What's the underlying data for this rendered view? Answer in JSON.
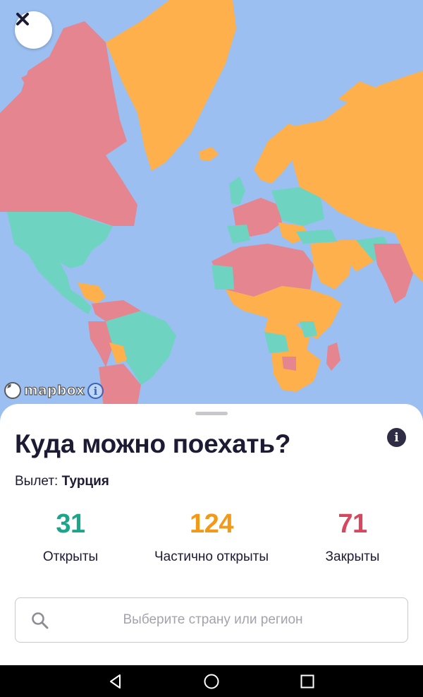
{
  "map": {
    "colors": {
      "water": "#9bbff0",
      "open": "#6fd3c1",
      "partial": "#fdb04c",
      "closed": "#e5858f"
    },
    "attribution_logo": "mapbox",
    "close_icon": "close-icon",
    "info_icon": "info-icon"
  },
  "sheet": {
    "title": "Куда можно поехать?",
    "departure_label": "Вылет:",
    "departure_country": "Турция",
    "stats": [
      {
        "value": "31",
        "label": "Открыты",
        "color": "#1aa68a"
      },
      {
        "value": "124",
        "label": "Частично открыты",
        "color": "#f29a17"
      },
      {
        "value": "71",
        "label": "Закрыты",
        "color": "#d64860"
      }
    ],
    "search": {
      "placeholder": "Выберите страну или регион",
      "value": ""
    }
  },
  "navbar": {
    "icons": [
      "back-icon",
      "home-icon",
      "recents-icon"
    ]
  }
}
